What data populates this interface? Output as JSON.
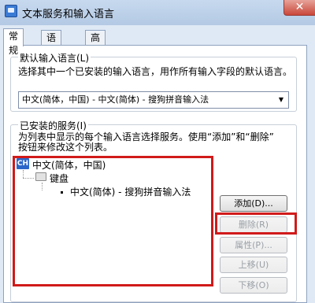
{
  "window": {
    "title": "文本服务和输入语言",
    "close_glyph": "✕",
    "app_icon": "keyboard-settings-icon"
  },
  "tabs": [
    {
      "label": "常规",
      "active": true
    },
    {
      "label": "语言栏",
      "active": false
    },
    {
      "label": "高级键设置",
      "active": false
    }
  ],
  "default_input": {
    "group_title": "默认输入语言(L)",
    "description": "选择其中一个已安装的输入语言，用作所有输入字段的默认语言。",
    "selected_value": "中文(简体，中国) - 中文(简体) - 搜狗拼音输入法"
  },
  "installed_services": {
    "group_title": "已安装的服务(I)",
    "description_line1": "为列表中显示的每个输入语言选择服务。使用“添加”和“删除”",
    "description_line2": "按钮来修改这个列表。",
    "tree": {
      "language_badge": "CH",
      "language": "中文(简体，中国)",
      "category": "键盘",
      "service": "中文(简体) - 搜狗拼音输入法"
    },
    "buttons": {
      "add": "添加(D)...",
      "remove": "删除(R)",
      "properties": "属性(P)...",
      "move_up": "上移(U)",
      "move_down": "下移(O)"
    }
  },
  "colors": {
    "highlight": "#d11a1a",
    "accent": "#2b67c9"
  }
}
